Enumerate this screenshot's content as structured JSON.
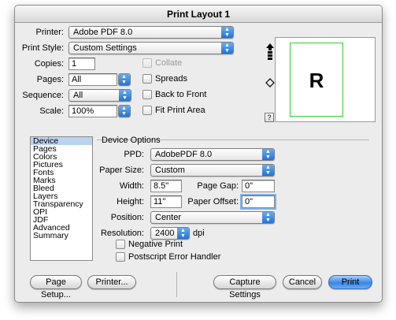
{
  "window": {
    "title": "Print Layout 1"
  },
  "setup": {
    "printer_label": "Printer:",
    "printer_value": "Adobe PDF 8.0",
    "print_style_label": "Print Style:",
    "print_style_value": "Custom Settings",
    "copies_label": "Copies:",
    "copies_value": "1",
    "pages_label": "Pages:",
    "pages_value": "All",
    "sequence_label": "Sequence:",
    "sequence_value": "All",
    "scale_label": "Scale:",
    "scale_value": "100%"
  },
  "checkboxes": {
    "collate": "Collate",
    "spreads": "Spreads",
    "back_to_front": "Back to Front",
    "fit_print_area": "Fit Print Area"
  },
  "preview": {
    "letter": "R",
    "help_glyph": "?"
  },
  "sidebar": {
    "items": [
      "Device",
      "Pages",
      "Colors",
      "Pictures",
      "Fonts",
      "Marks",
      "Bleed",
      "Layers",
      "Transparency",
      "OPI",
      "JDF",
      "Advanced",
      "Summary"
    ],
    "selected": "Device"
  },
  "device_options": {
    "title": "Device Options",
    "ppd_label": "PPD:",
    "ppd_value": "AdobePDF 8.0",
    "paper_size_label": "Paper Size:",
    "paper_size_value": "Custom",
    "width_label": "Width:",
    "width_value": "8.5\"",
    "page_gap_label": "Page Gap:",
    "page_gap_value": "0\"",
    "height_label": "Height:",
    "height_value": "11\"",
    "paper_offset_label": "Paper Offset:",
    "paper_offset_value": "0\"",
    "position_label": "Position:",
    "position_value": "Center",
    "resolution_label": "Resolution:",
    "resolution_value": "2400",
    "resolution_unit": "dpi",
    "negative_print": "Negative Print",
    "postscript_error_handler": "Postscript Error Handler"
  },
  "buttons": {
    "page_setup": "Page Setup...",
    "printer": "Printer...",
    "capture_settings": "Capture Settings",
    "cancel": "Cancel",
    "print": "Print"
  },
  "colors": {
    "accent": "#3b86e0",
    "page_outline": "#29d429",
    "list_selection": "#bcd3f0"
  }
}
